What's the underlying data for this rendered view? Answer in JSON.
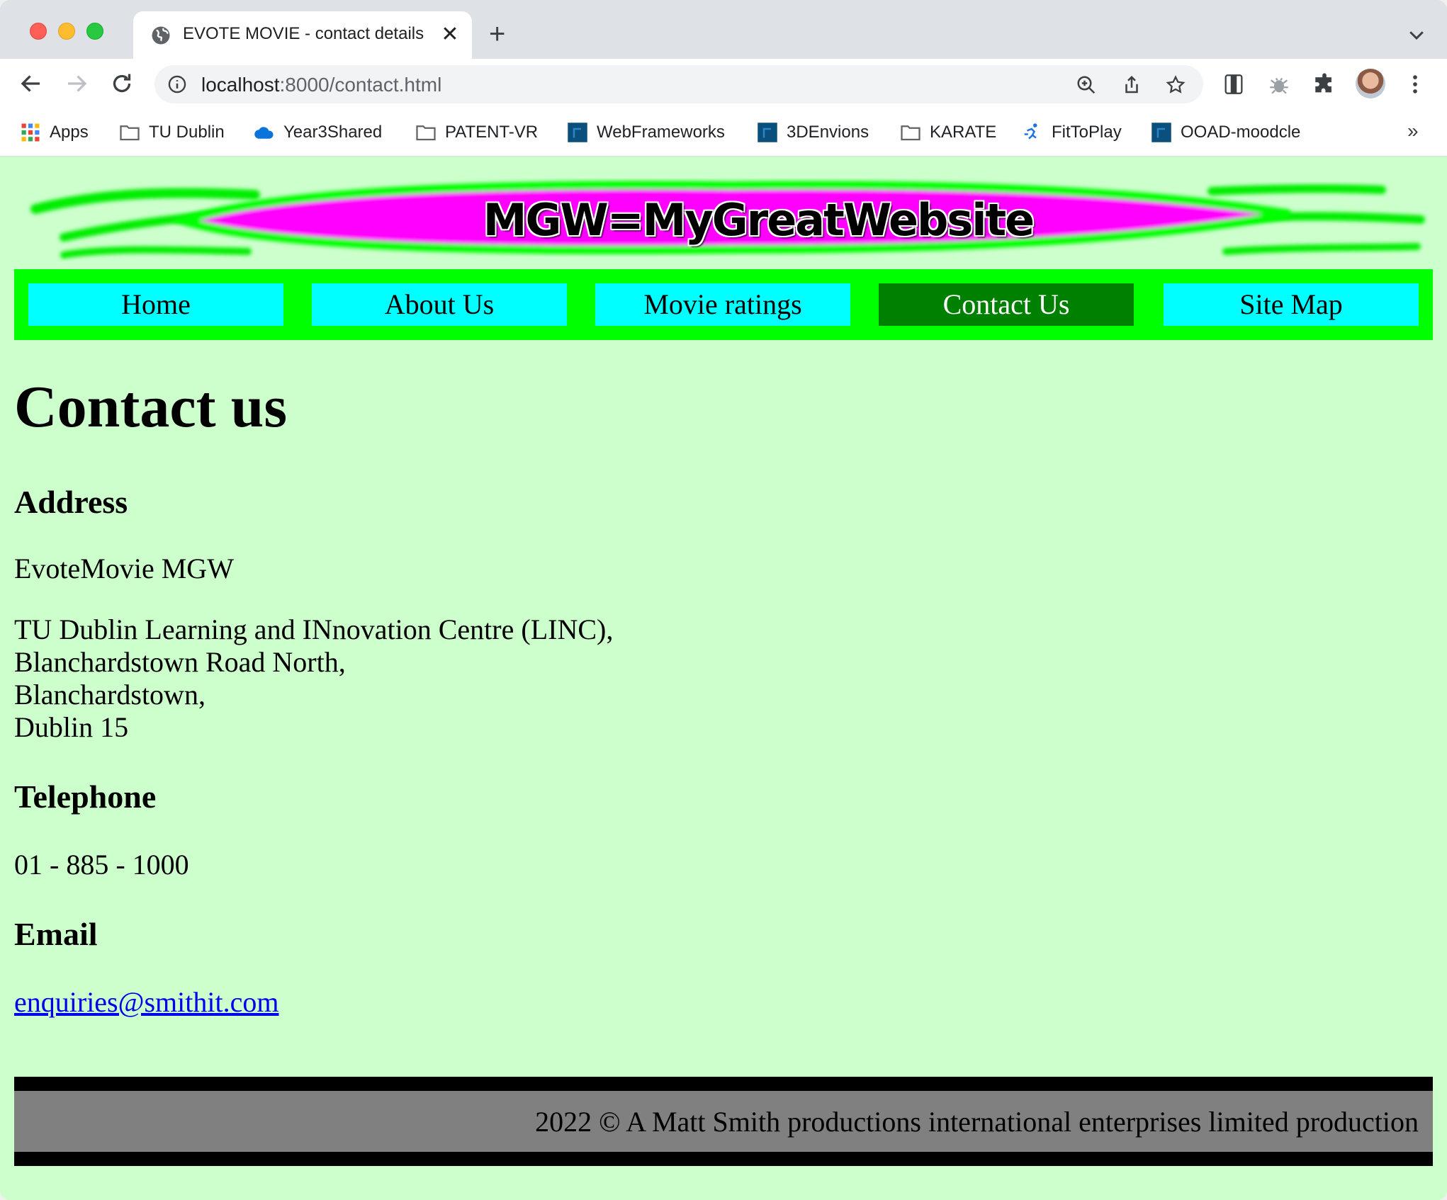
{
  "browser": {
    "tab_title": "EVOTE MOVIE - contact details",
    "tab_close": "✕",
    "new_tab": "+",
    "url_host": "localhost",
    "url_rest": ":8000/contact.html"
  },
  "bookmarks": [
    {
      "label": "Apps",
      "icon": "apps-grid-icon"
    },
    {
      "label": "TU Dublin",
      "icon": "folder-icon"
    },
    {
      "label": "Year3Shared",
      "icon": "onedrive-cloud-icon"
    },
    {
      "label": "PATENT-VR",
      "icon": "folder-icon"
    },
    {
      "label": "WebFrameworks",
      "icon": "site-favicon-icon"
    },
    {
      "label": "3DEnvions",
      "icon": "site-favicon-icon"
    },
    {
      "label": "KARATE",
      "icon": "folder-icon"
    },
    {
      "label": "FitToPlay",
      "icon": "runner-icon"
    },
    {
      "label": "OOAD-moodcle",
      "icon": "site-favicon-icon"
    }
  ],
  "bookmarks_more": "»",
  "site": {
    "banner_text": "MGW=MyGreatWebsite",
    "nav": [
      {
        "label": "Home",
        "active": false
      },
      {
        "label": "About Us",
        "active": false
      },
      {
        "label": "Movie ratings",
        "active": false
      },
      {
        "label": "Contact Us",
        "active": true
      },
      {
        "label": "Site Map",
        "active": false
      }
    ],
    "colors": {
      "page_bg": "#ccffcc",
      "nav_bar": "#00ff00",
      "nav_item": "#00ffff",
      "nav_active": "#008000",
      "banner_fill": "#ff00ff",
      "footer_bg": "#808080"
    }
  },
  "content": {
    "title": "Contact us",
    "address_heading": "Address",
    "org_name": "EvoteMovie MGW",
    "address_lines": [
      "TU Dublin Learning and INnovation Centre (LINC),",
      "Blanchardstown Road North,",
      "Blanchardstown,",
      "Dublin 15"
    ],
    "telephone_heading": "Telephone",
    "telephone": "01 - 885 - 1000",
    "email_heading": "Email",
    "email": "enquiries@smithit.com"
  },
  "footer": {
    "text": "2022 © A Matt Smith productions international enterprises limited production"
  }
}
